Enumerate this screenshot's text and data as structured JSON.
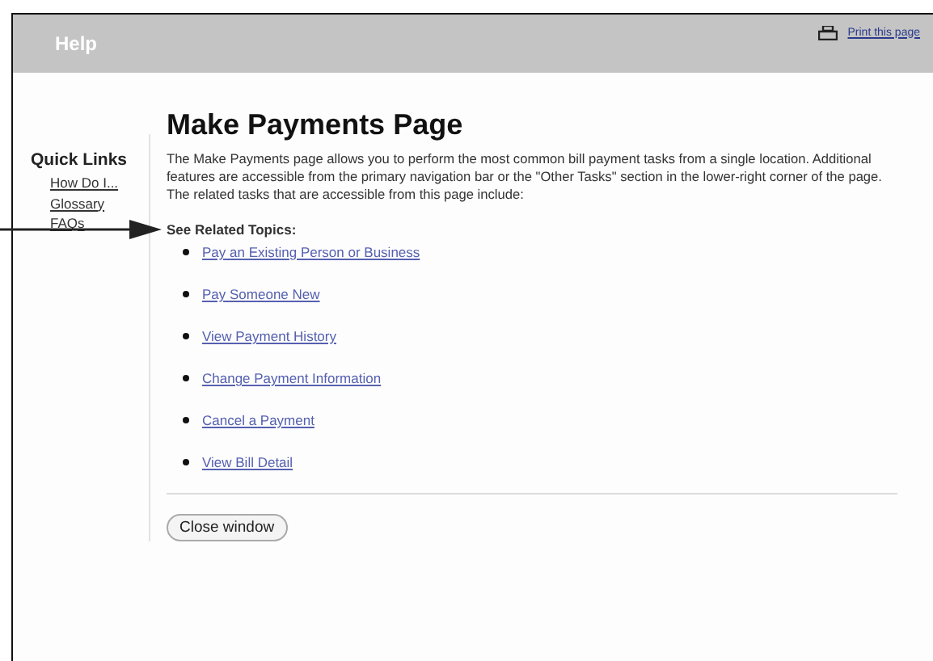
{
  "header": {
    "title": "Help",
    "print_link": "Print this page"
  },
  "sidebar": {
    "title": "Quick Links",
    "links": [
      "How Do I...",
      "Glossary",
      "FAQs"
    ]
  },
  "main": {
    "title": "Make Payments Page",
    "description": "The Make Payments page allows you to perform the most common bill payment tasks from a single location. Additional features are accessible from the primary navigation bar or the \"Other Tasks\" section in the lower-right corner of the page. The related tasks that are accessible from this page include:",
    "related_heading": "See Related Topics:",
    "topics": [
      "Pay an Existing Person or Business",
      "Pay Someone New",
      "View Payment History",
      "Change Payment Information",
      "Cancel a Payment",
      "View Bill Detail"
    ],
    "close_button": "Close window"
  }
}
